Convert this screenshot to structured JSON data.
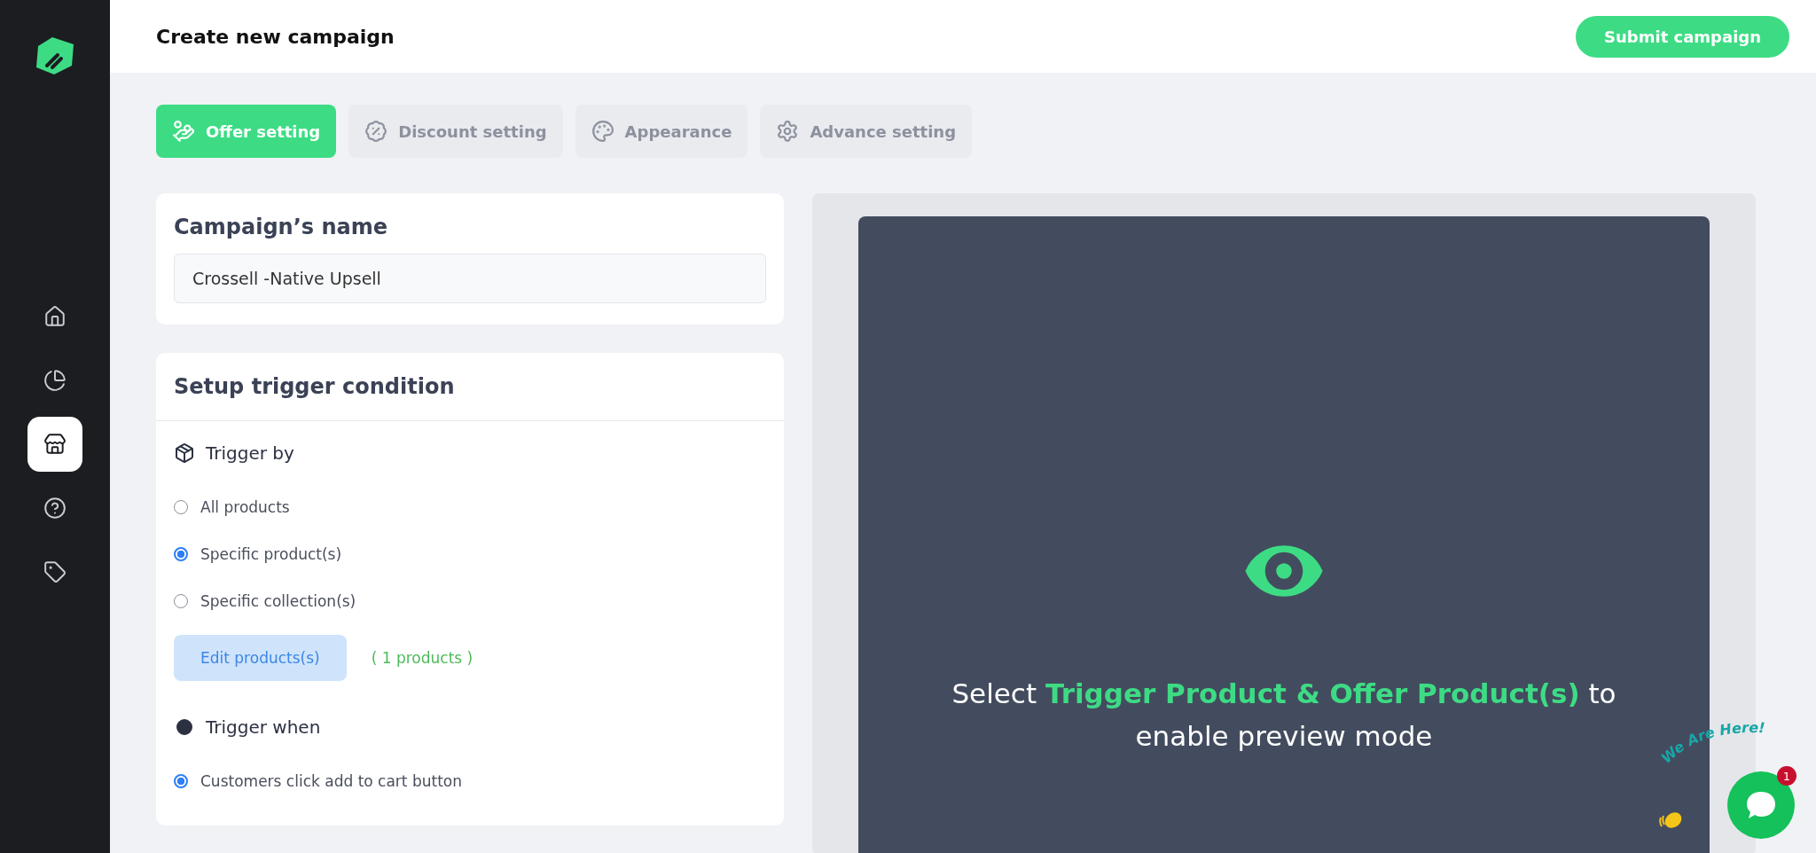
{
  "header": {
    "title": "Create new campaign",
    "submit_button": "Submit campaign"
  },
  "sidebar": {
    "items": [
      {
        "kind": "home",
        "selected": false
      },
      {
        "kind": "chart",
        "selected": false
      },
      {
        "kind": "store",
        "selected": true
      },
      {
        "kind": "help",
        "selected": false
      },
      {
        "kind": "tag",
        "selected": false
      }
    ]
  },
  "tabs": [
    {
      "label": "Offer setting",
      "kind": "offer",
      "selected": true
    },
    {
      "label": "Discount setting",
      "kind": "discount",
      "selected": false
    },
    {
      "label": "Appearance",
      "kind": "palette",
      "selected": false
    },
    {
      "label": "Advance setting",
      "kind": "gear",
      "selected": false
    }
  ],
  "campaign_name": {
    "heading": "Campaign’s name",
    "value": "Crossell -Native Upsell"
  },
  "trigger": {
    "heading": "Setup trigger condition",
    "trigger_by": {
      "label": "Trigger by",
      "options": [
        {
          "label": "All products",
          "selected": false
        },
        {
          "label": "Specific product(s)",
          "selected": true
        },
        {
          "label": "Specific collection(s)",
          "selected": false
        }
      ]
    },
    "edit_button": "Edit products(s)",
    "count": "( 1 products )",
    "trigger_when": {
      "label": "Trigger when",
      "options": [
        {
          "label": "Customers click add to cart button",
          "selected": true
        }
      ]
    }
  },
  "preview": {
    "message": "Select **Trigger Product & Offer Product(s)** to enable preview mode"
  },
  "chat": {
    "caption": "We Are Here!",
    "badge": "1"
  }
}
